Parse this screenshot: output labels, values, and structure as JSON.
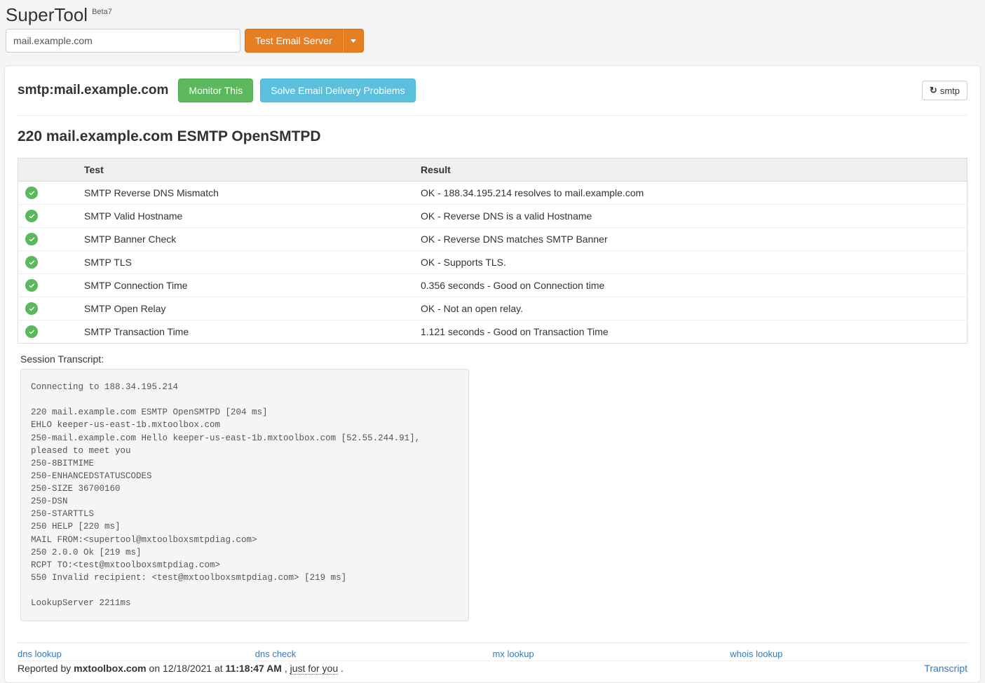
{
  "header": {
    "title": "SuperTool",
    "beta_label": "Beta7",
    "domain_input_value": "mail.example.com",
    "action_button_label": "Test Email Server"
  },
  "query": {
    "title": "smtp:mail.example.com",
    "monitor_label": "Monitor This",
    "solve_label": "Solve Email Delivery Problems",
    "refresh_label": "smtp"
  },
  "banner": "220 mail.example.com ESMTP OpenSMTPD",
  "table": {
    "col_test": "Test",
    "col_result": "Result",
    "rows": [
      {
        "status": "ok",
        "test": "SMTP Reverse DNS Mismatch",
        "result": "OK - 188.34.195.214 resolves to mail.example.com"
      },
      {
        "status": "ok",
        "test": "SMTP Valid Hostname",
        "result": "OK - Reverse DNS is a valid Hostname"
      },
      {
        "status": "ok",
        "test": "SMTP Banner Check",
        "result": "OK - Reverse DNS matches SMTP Banner"
      },
      {
        "status": "ok",
        "test": "SMTP TLS",
        "result": "OK - Supports TLS."
      },
      {
        "status": "ok",
        "test": "SMTP Connection Time",
        "result": "0.356 seconds - Good on Connection time"
      },
      {
        "status": "ok",
        "test": "SMTP Open Relay",
        "result": "OK - Not an open relay."
      },
      {
        "status": "ok",
        "test": "SMTP Transaction Time",
        "result": "1.121 seconds - Good on Transaction Time"
      }
    ]
  },
  "transcript": {
    "label": "Session Transcript:",
    "text": "Connecting to 188.34.195.214\n\n220 mail.example.com ESMTP OpenSMTPD [204 ms]\nEHLO keeper-us-east-1b.mxtoolbox.com\n250-mail.example.com Hello keeper-us-east-1b.mxtoolbox.com [52.55.244.91],\npleased to meet you\n250-8BITMIME\n250-ENHANCEDSTATUSCODES\n250-SIZE 36700160\n250-DSN\n250-STARTTLS\n250 HELP [220 ms]\nMAIL FROM:<supertool@mxtoolboxsmtpdiag.com>\n250 2.0.0 Ok [219 ms]\nRCPT TO:<test@mxtoolboxsmtpdiag.com>\n550 Invalid recipient: <test@mxtoolboxsmtpdiag.com> [219 ms]\n\nLookupServer 2211ms"
  },
  "footer": {
    "links": [
      "dns lookup",
      "dns check",
      "mx lookup",
      "whois lookup"
    ],
    "reported_prefix": "Reported by ",
    "reported_site": "mxtoolbox.com",
    "reported_on": " on 12/18/2021 at ",
    "reported_time": "11:18:47 AM",
    "reported_suffix_prefix": ", ",
    "reported_suffix_link": "just for you",
    "reported_suffix_end": ".",
    "transcript_link": "Transcript"
  }
}
